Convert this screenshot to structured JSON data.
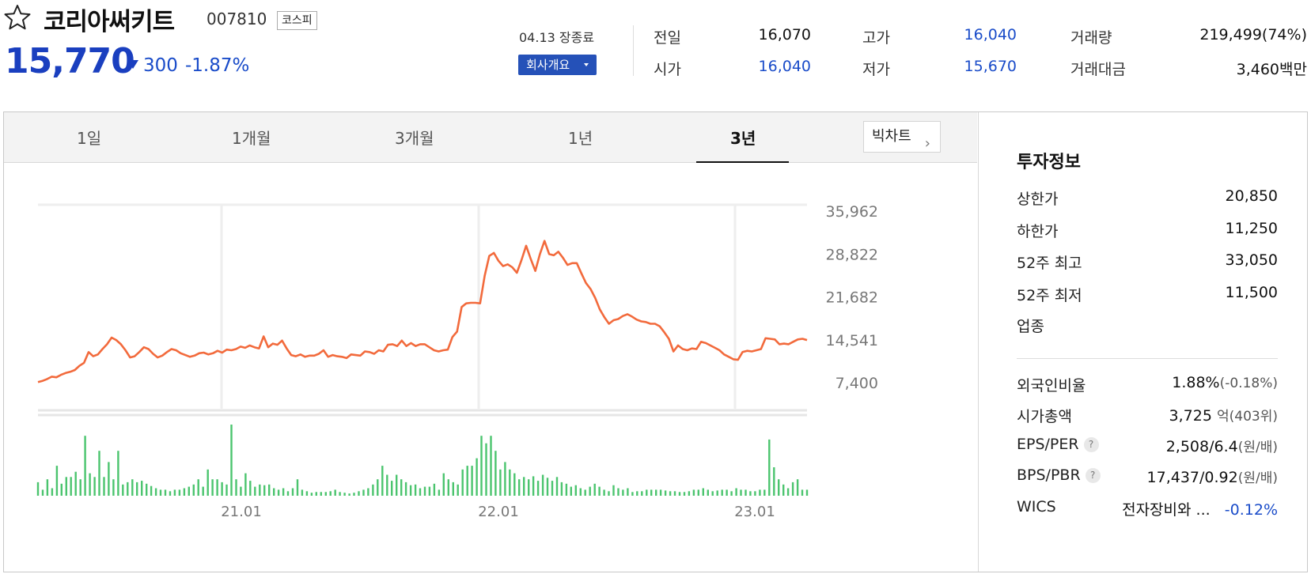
{
  "stock": {
    "name": "코리아써키트",
    "code": "007810",
    "market": "코스피",
    "price": "15,770",
    "change": "300",
    "change_pct": "-1.87%",
    "date_status": "04.13 장종료",
    "company_info_button": "회사개요"
  },
  "quote": {
    "prev_close_label": "전일",
    "prev_close": "16,070",
    "open_label": "시가",
    "open": "16,040",
    "high_label": "고가",
    "high": "16,040",
    "low_label": "저가",
    "low": "15,670",
    "volume_label": "거래량",
    "volume": "219,499(74%)",
    "amount_label": "거래대금",
    "amount": "3,460",
    "amount_unit": "백만"
  },
  "tabs": [
    "1일",
    "1개월",
    "3개월",
    "1년",
    "3년"
  ],
  "active_tab": "3년",
  "big_chart_button": "빅차트",
  "invest": {
    "title": "투자정보",
    "upper_limit_label": "상한가",
    "upper_limit": "20,850",
    "lower_limit_label": "하한가",
    "lower_limit": "11,250",
    "high52_label": "52주 최고",
    "high52": "33,050",
    "low52_label": "52주 최저",
    "low52": "11,500",
    "sector_label": "업종",
    "foreign_label": "외국인비율",
    "foreign": "1.88%",
    "foreign_change": "(-0.18%)",
    "mktcap_label": "시가총액",
    "mktcap": "3,725",
    "mktcap_unit": "억(403위)",
    "eps_per_label": "EPS/PER",
    "eps_per": "2,508/6.4",
    "eps_per_unit": "(원/배)",
    "bps_pbr_label": "BPS/PBR",
    "bps_pbr": "17,437/0.92",
    "bps_pbr_unit": "(원/배)",
    "wics_label": "WICS",
    "wics": "전자장비와 ...",
    "wics_change": "-0.12%"
  },
  "colors": {
    "up": "#e0201a",
    "down": "#1a4cc9",
    "line": "#f26a3c",
    "volume": "#4bc46e"
  },
  "chart_data": {
    "type": "line",
    "y_ticks": [
      "35,962",
      "28,822",
      "21,682",
      "14,541",
      "7,400"
    ],
    "ylim": [
      7400,
      35962
    ],
    "x_ticks": [
      "21.01",
      "22.01",
      "23.01"
    ],
    "grid": true,
    "series": [
      {
        "values": [
          7500,
          7700,
          8000,
          8400,
          8300,
          8700,
          9000,
          9200,
          9500,
          10200,
          10700,
          12500,
          11800,
          12100,
          13000,
          13800,
          14900,
          14500,
          13800,
          12800,
          11600,
          11800,
          12500,
          13300,
          13000,
          12200,
          11600,
          11900,
          12500,
          13000,
          12800,
          12300,
          12000,
          11700,
          11900,
          12300,
          12400,
          12100,
          12300,
          12700,
          12400,
          12900,
          12800,
          13000,
          13400,
          13200,
          13600,
          13300,
          13100,
          15100,
          13300,
          13900,
          13700,
          14400,
          13100,
          12000,
          11800,
          12100,
          11700,
          11900,
          11900,
          12200,
          12800,
          11700,
          12000,
          11800,
          11700,
          11500,
          12100,
          12000,
          11900,
          12600,
          12500,
          12200,
          12800,
          12600,
          13700,
          13800,
          13500,
          14400,
          13500,
          14000,
          13500,
          13800,
          13800,
          13300,
          12800,
          12600,
          12800,
          12900,
          15000,
          15900,
          20000,
          20600,
          20700,
          20700,
          20600,
          25200,
          28500,
          29000,
          27700,
          26800,
          27100,
          26600,
          25700,
          27800,
          30200,
          28000,
          26000,
          28800,
          31000,
          28800,
          28600,
          29200,
          28200,
          27000,
          27300,
          27300,
          25600,
          24000,
          23000,
          21500,
          19600,
          18300,
          17200,
          17800,
          18000,
          18500,
          18800,
          18400,
          17900,
          17600,
          17500,
          17200,
          17200,
          16800,
          15800,
          14700,
          12600,
          13600,
          13000,
          12800,
          13100,
          13000,
          14200,
          14000,
          13600,
          13200,
          12800,
          12100,
          11700,
          11300,
          11200,
          12500,
          12700,
          12600,
          12800,
          13000,
          14800,
          14700,
          14600,
          13800,
          13900,
          13800,
          14200,
          14600,
          14700,
          14500
        ]
      }
    ],
    "volume": [
      18,
      8,
      22,
      10,
      40,
      16,
      25,
      25,
      32,
      22,
      80,
      30,
      25,
      60,
      25,
      45,
      22,
      60,
      15,
      18,
      22,
      18,
      20,
      16,
      13,
      10,
      8,
      8,
      6,
      8,
      8,
      10,
      12,
      15,
      22,
      12,
      35,
      22,
      22,
      18,
      15,
      95,
      22,
      12,
      30,
      20,
      12,
      15,
      14,
      15,
      10,
      8,
      10,
      6,
      10,
      22,
      8,
      6,
      4,
      5,
      5,
      5,
      6,
      8,
      5,
      4,
      3,
      4,
      6,
      8,
      10,
      15,
      22,
      40,
      28,
      20,
      28,
      22,
      18,
      14,
      15,
      10,
      12,
      12,
      16,
      8,
      30,
      22,
      18,
      15,
      35,
      40,
      40,
      50,
      80,
      70,
      80,
      60,
      35,
      45,
      35,
      30,
      22,
      25,
      22,
      26,
      20,
      28,
      24,
      20,
      25,
      18,
      16,
      12,
      14,
      10,
      8,
      12,
      16,
      12,
      8,
      6,
      14,
      10,
      8,
      10,
      5,
      6,
      6,
      8,
      8,
      8,
      8,
      7,
      6,
      6,
      5,
      5,
      6,
      8,
      8,
      10,
      8,
      6,
      7,
      8,
      8,
      6,
      10,
      8,
      8,
      6,
      6,
      8,
      8,
      75,
      38,
      22,
      15,
      10,
      18,
      22,
      8,
      8
    ]
  }
}
